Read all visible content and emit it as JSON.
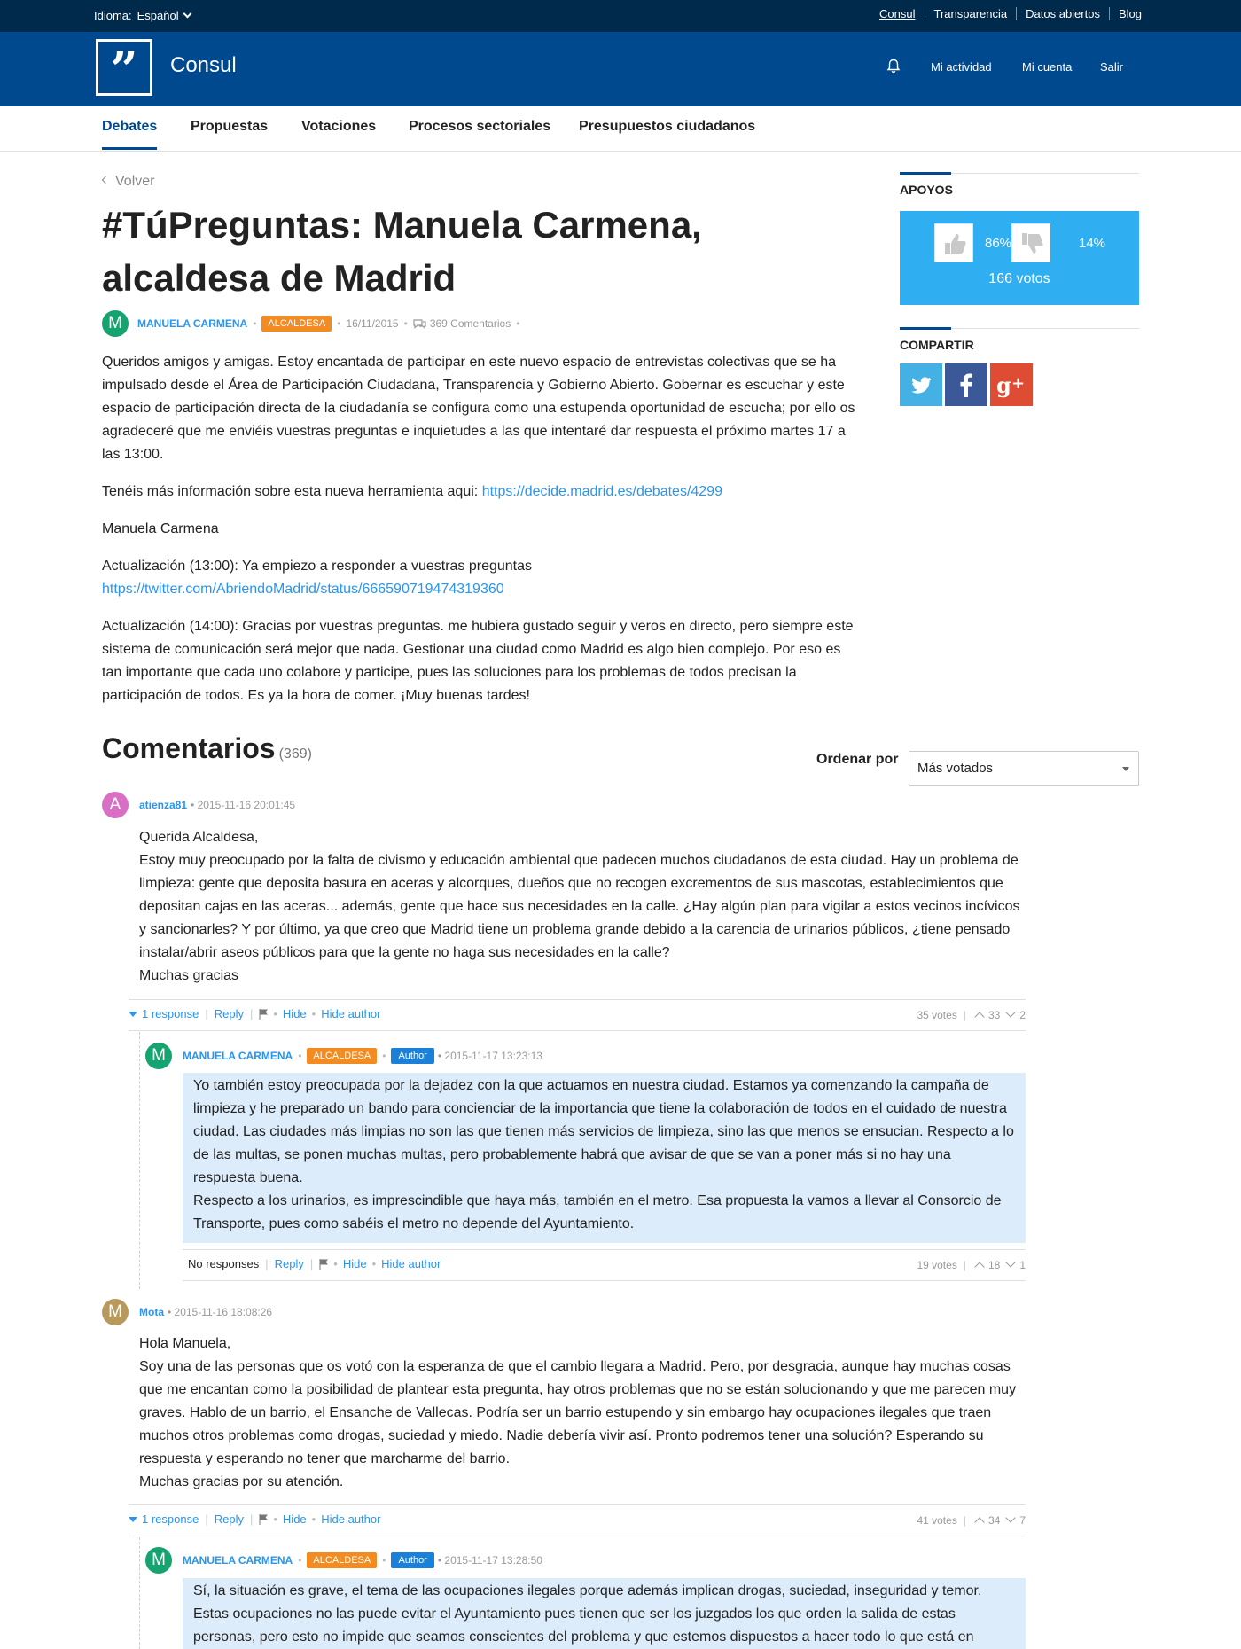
{
  "colors": {
    "header": "#00498f",
    "top_strip": "#002a4c",
    "link": "#2895f1",
    "supports": "#30aef2",
    "official": "#f28c22",
    "author": "#1a80d8",
    "reply_bg": "#dcecfb"
  },
  "topbar": {
    "language_label": "Idioma:",
    "language_value": "Español",
    "links": [
      "Consul",
      "Transparencia",
      "Datos abiertos",
      "Blog"
    ]
  },
  "header": {
    "logo_icon": "quote-marks",
    "site_name": "Consul",
    "notifications_icon": "bell-icon",
    "links": [
      "Mi actividad",
      "Mi cuenta",
      "Salir"
    ]
  },
  "nav": {
    "items": [
      "Debates",
      "Propuestas",
      "Votaciones",
      "Procesos sectoriales",
      "Presupuestos ciudadanos"
    ],
    "active": "Debates"
  },
  "debate": {
    "back_label": "Volver",
    "title": "#TúPreguntas: Manuela Carmena, alcaldesa de Madrid",
    "author_initial": "M",
    "author": "MANUELA CARMENA",
    "official_badge": "ALCALDESA",
    "date": "16/11/2015",
    "comments_label": "369 Comentarios",
    "paragraphs": {
      "p1": "Queridos amigos y amigas. Estoy encantada de participar en este nuevo espacio de entrevistas colectivas que se ha impulsado desde el Área de Participación Ciudadana, Transparencia y Gobierno Abierto. Gobernar es escuchar y este espacio de participación directa de la ciudadanía se configura como una estupenda oportunidad de escucha; por ello os agradeceré que me enviéis vuestras preguntas e inquietudes a las que intentaré dar respuesta el próximo martes 17 a las 13:00.",
      "p2_text": "Tenéis más información sobre esta nueva herramienta aqui:",
      "p2_link": "https://decide.madrid.es/debates/4299",
      "p3": "Manuela Carmena",
      "p4_text": "Actualización (13:00): Ya empiezo a responder a vuestras preguntas",
      "p4_link": "https://twitter.com/AbriendoMadrid/status/666590719474319360",
      "p5": "Actualización (14:00): Gracias por vuestras preguntas. me hubiera gustado seguir y veros en directo, pero siempre este sistema de comunicación será mejor que nada. Gestionar una ciudad como Madrid es algo bien complejo. Por eso es tan importante que cada uno colabore y participe, pues las soluciones para los problemas de todos precisan la participación de todos. Es ya la hora de comer. ¡Muy buenas tardes!"
    }
  },
  "sidebar": {
    "supports_title": "APOYOS",
    "like_icon": "thumbs-up-icon",
    "dislike_icon": "thumbs-down-icon",
    "like_pct": "86%",
    "dislike_pct": "14%",
    "total_votes": "166 votos",
    "share_title": "COMPARTIR",
    "share_icons": [
      "twitter-icon",
      "facebook-icon",
      "google-plus-icon"
    ],
    "share_colors": [
      "#45b0e3",
      "#3b5998",
      "#de4c34"
    ]
  },
  "comments": {
    "title": "Comentarios",
    "count": "(369)",
    "order_label": "Ordenar por",
    "order_value": "Más votados",
    "items": [
      {
        "initial": "A",
        "author": "atienza81",
        "date": "• 2015-11-16 20:01:45",
        "body": "Querida Alcaldesa,\nEstoy muy preocupado por la falta de civismo y educación ambiental que padecen muchos ciudadanos de esta ciudad. Hay un problema de limpieza: gente que deposita basura en aceras y alcorques, dueños que no recogen excrementos de sus mascotas, establecimientos que depositan cajas en las aceras... además, gente que hace sus necesidades en la calle. ¿Hay algún plan para vigilar a estos vecinos incívicos y sancionarles? Y por último, ya que creo que Madrid tiene un problema grande debido a la carencia de urinarios públicos, ¿tiene pensado instalar/abrir aseos públicos para que la gente no haga sus necesidades en la calle?\nMuchas gracias",
        "responses": "1 response",
        "reply": "Reply",
        "hide": "Hide",
        "hide_author": "Hide author",
        "votes": "35 votes",
        "up": "33",
        "down": "2",
        "reply_item": {
          "initial": "M",
          "author": "MANUELA CARMENA",
          "badge": "ALCALDESA",
          "author_badge": "Author",
          "date": "• 2015-11-17 13:23:13",
          "body": "Yo también estoy preocupada por la dejadez con la que actuamos en nuestra ciudad. Estamos ya comenzando la campaña de limpieza y he preparado un bando para concienciar de la importancia que tiene la colaboración de todos en el cuidado de nuestra ciudad. Las ciudades más limpias no son las que tienen más servicios de limpieza, sino las que menos se ensucian. Respecto a lo de las multas, se ponen muchas multas, pero probablemente habrá que avisar de que se van a poner más si no hay una respuesta buena.\nRespecto a los urinarios, es imprescindible que haya más, también en el metro. Esa propuesta la vamos a llevar al Consorcio de Transporte, pues como sabéis el metro no depende del Ayuntamiento.",
          "responses": "No responses",
          "reply": "Reply",
          "hide": "Hide",
          "hide_author": "Hide author",
          "votes": "19 votes",
          "up": "18",
          "down": "1"
        }
      },
      {
        "initial": "M",
        "author": "Mota",
        "date": "• 2015-11-16 18:08:26",
        "body": "Hola Manuela,\nSoy una de las personas que os votó con la esperanza de que el cambio llegara a Madrid. Pero, por desgracia, aunque hay muchas cosas que me encantan como la posibilidad de plantear esta pregunta, hay otros problemas que no se están solucionando y que me parecen muy graves. Hablo de un barrio, el Ensanche de Vallecas. Podría ser un barrio estupendo y sin embargo hay ocupaciones ilegales que traen muchos otros problemas como drogas, suciedad y miedo. Nadie debería vivir así. Pronto podremos tener una solución? Esperando su respuesta y esperando no tener que marcharme del barrio.\nMuchas gracias por su atención.",
        "responses": "1 response",
        "reply": "Reply",
        "hide": "Hide",
        "hide_author": "Hide author",
        "votes": "41 votes",
        "up": "34",
        "down": "7",
        "reply_item": {
          "initial": "M",
          "author": "MANUELA CARMENA",
          "badge": "ALCALDESA",
          "author_badge": "Author",
          "date": "• 2015-11-17 13:28:50",
          "body": "Sí, la situación es grave, el tema de las ocupaciones ilegales porque además implican drogas, suciedad, inseguridad y temor. Estas ocupaciones no las puede evitar el Ayuntamiento pues tienen que ser los juzgados los que orden la salida de estas personas, pero esto no impide que seamos conscientes del problema y que estemos dispuestos a hacer todo lo que está en nuestra mano. Ya"
        }
      }
    ]
  }
}
